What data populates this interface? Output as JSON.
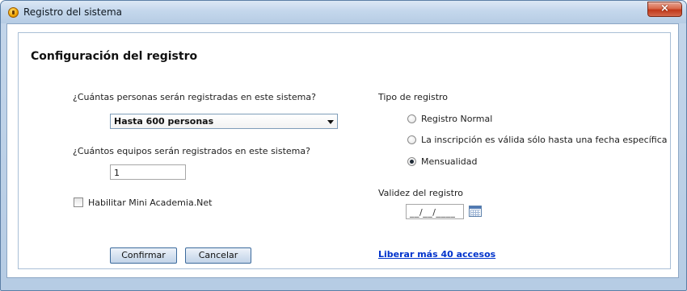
{
  "window": {
    "title": "Registro del sistema",
    "close_glyph": "×"
  },
  "form": {
    "heading": "Configuración del registro",
    "persons_question": "¿Cuántas personas serán registradas en este sistema?",
    "persons_selected": "Hasta 600 personas",
    "equipment_question": "¿Cuántos equipos serán registrados en este sistema?",
    "equipment_value": "1",
    "mini_academia_label": "Habilitar Mini Academia.Net",
    "mini_academia_checked": false
  },
  "registration_type": {
    "label": "Tipo de registro",
    "options": [
      {
        "label": "Registro Normal",
        "checked": false
      },
      {
        "label": "La inscripción es válida sólo hasta una fecha específica",
        "checked": false
      },
      {
        "label": "Mensualidad",
        "checked": true
      }
    ]
  },
  "validity": {
    "label": "Validez del registro",
    "date_placeholder": "__/__/____"
  },
  "buttons": {
    "confirm": "Confirmar",
    "cancel": "Cancelar"
  },
  "link": {
    "release_access": "Liberar más 40 accesos"
  },
  "colors": {
    "accent": "#3c6a9c",
    "link": "#0033cc",
    "close": "#c0381a"
  }
}
